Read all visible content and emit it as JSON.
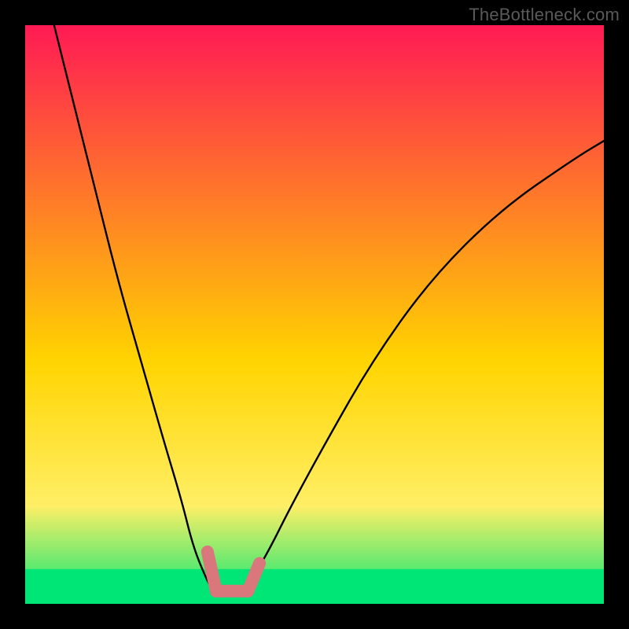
{
  "watermark": "TheBottleneck.com",
  "chart_data": {
    "type": "line",
    "title": "",
    "xlabel": "",
    "ylabel": "",
    "xlim": [
      0,
      100
    ],
    "ylim": [
      0,
      100
    ],
    "grid": false,
    "legend": false,
    "background_gradient_top": "#ff1a54",
    "background_gradient_mid": "#ffd400",
    "background_gradient_bottom": "#00e676",
    "green_band_y": [
      0,
      6
    ],
    "series": [
      {
        "name": "curve",
        "x": [
          5,
          8,
          12,
          16,
          20,
          24,
          27,
          29,
          31,
          32.5,
          34,
          35,
          37,
          39,
          42,
          46,
          52,
          60,
          70,
          82,
          95,
          100
        ],
        "y": [
          100,
          88,
          72,
          56,
          42,
          28,
          18,
          10,
          5,
          2,
          2,
          2,
          2,
          4,
          9,
          17,
          28,
          42,
          56,
          68,
          77,
          80
        ]
      }
    ],
    "markers": {
      "name": "highlight-segment",
      "color": "#d9777c",
      "segments": [
        {
          "x1": 31.5,
          "y1": 9.0,
          "x2": 33.0,
          "y2": 2.2
        },
        {
          "x1": 33.0,
          "y1": 2.2,
          "x2": 38.5,
          "y2": 2.2
        },
        {
          "x1": 38.5,
          "y1": 2.2,
          "x2": 40.5,
          "y2": 7.0
        }
      ]
    }
  }
}
